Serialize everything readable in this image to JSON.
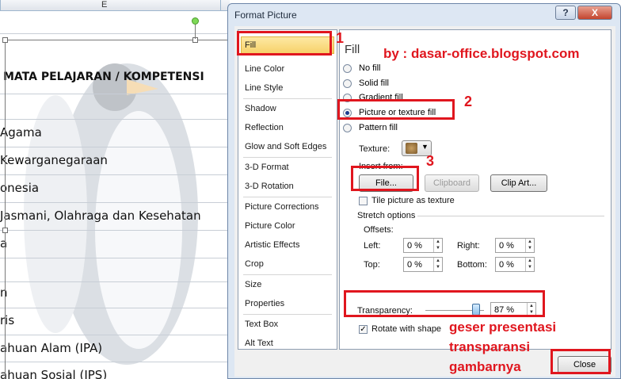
{
  "sheet": {
    "column_letter": "E",
    "header_row": "MATA PELAJARAN / KOMPETENSI",
    "rows": [
      "Agama",
      "Kewarganegaraan",
      "onesia",
      "Jasmani, Olahraga dan Kesehatan",
      "a",
      "",
      "n",
      "ris",
      "ahuan Alam (IPA)",
      "ahuan Sosial (IPS)"
    ]
  },
  "dialog": {
    "title": "Format Picture",
    "help_label": "?",
    "close_x_label": "X",
    "nav_items": [
      "Fill",
      "Line Color",
      "Line Style",
      "Shadow",
      "Reflection",
      "Glow and Soft Edges",
      "3-D Format",
      "3-D Rotation",
      "Picture Corrections",
      "Picture Color",
      "Artistic Effects",
      "Crop",
      "Size",
      "Properties",
      "Text Box",
      "Alt Text"
    ],
    "fill": {
      "heading": "Fill",
      "options": [
        "No fill",
        "Solid fill",
        "Gradient fill",
        "Picture or texture fill",
        "Pattern fill"
      ],
      "selected": "Picture or texture fill",
      "texture_label": "Texture:",
      "insert_from_label": "Insert from:",
      "file_button": "File...",
      "clipboard_button": "Clipboard",
      "clipart_button": "Clip Art...",
      "tile_label": "Tile picture as texture",
      "stretch_label": "Stretch options",
      "offsets_label": "Offsets:",
      "left_label": "Left:",
      "left_value": "0 %",
      "right_label": "Right:",
      "right_value": "0 %",
      "top_label": "Top:",
      "top_value": "0 %",
      "bottom_label": "Bottom:",
      "bottom_value": "0 %",
      "transparency_label": "Transparency:",
      "transparency_value": "87 %",
      "transparency_level": 0.87,
      "rotate_label": "Rotate with shape"
    },
    "close_button": "Close"
  },
  "annotations": {
    "watermark": "by : dasar-office.blogspot.com",
    "num1": "1",
    "num2": "2",
    "num3": "3",
    "note_line1": "geser presentasi",
    "note_line2": "transparansi",
    "note_line3": "gambarnya",
    "color": "#e0161e"
  }
}
